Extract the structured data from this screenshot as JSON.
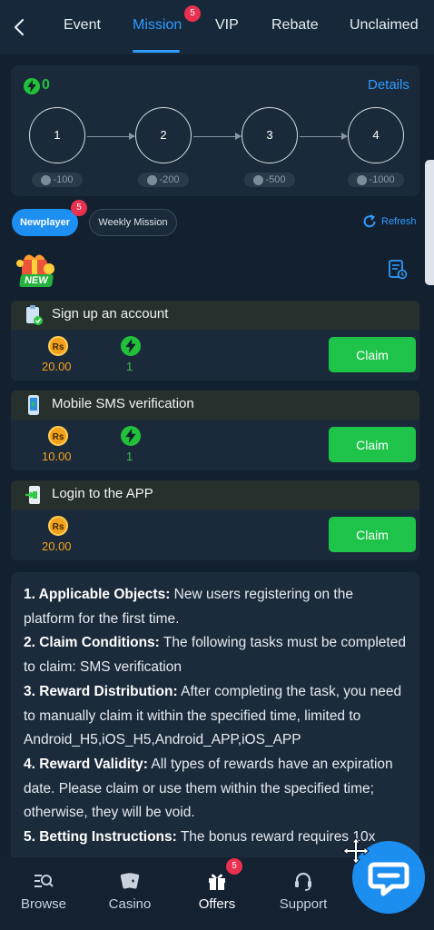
{
  "tabs": [
    {
      "label": "Event"
    },
    {
      "label": "Mission",
      "badge": "5",
      "active": true
    },
    {
      "label": "VIP"
    },
    {
      "label": "Rebate"
    },
    {
      "label": "Unclaimed"
    }
  ],
  "progress": {
    "energy_value": "0",
    "details_label": "Details",
    "steps": [
      {
        "label": "1",
        "requirement": "-100"
      },
      {
        "label": "2",
        "requirement": "-200"
      },
      {
        "label": "3",
        "requirement": "-500"
      },
      {
        "label": "4",
        "requirement": "-1000"
      }
    ]
  },
  "filters": {
    "newplayer_label": "Newplayer",
    "newplayer_badge": "5",
    "weekly_label": "Weekly Mission",
    "refresh_label": "Refresh"
  },
  "new_badge_text": "NEW",
  "tasks": [
    {
      "title": "Sign up an account",
      "rs_icon": "Rs",
      "rs_value": "20.00",
      "energy_value": "1",
      "claim_label": "Claim"
    },
    {
      "title": "Mobile SMS verification",
      "rs_icon": "Rs",
      "rs_value": "10.00",
      "energy_value": "1",
      "claim_label": "Claim"
    },
    {
      "title": "Login to the APP",
      "rs_icon": "Rs",
      "rs_value": "20.00",
      "claim_label": "Claim"
    }
  ],
  "rules": [
    {
      "heading": "1. Applicable Objects:",
      "text": " New users registering on the platform for the first time."
    },
    {
      "heading": "2. Claim Conditions:",
      "text": " The following tasks must be completed to claim: SMS verification"
    },
    {
      "heading": "3. Reward Distribution:",
      "text": " After completing the task, you need to manually claim it within the specified time, limited to Android_H5,iOS_H5,Android_APP,iOS_APP"
    },
    {
      "heading": "4. Reward Validity:",
      "text": " All types of rewards have an expiration date. Please claim or use them within the specified time; otherwise, they will be void."
    },
    {
      "heading": "5. Betting Instructions:",
      "text": " The bonus reward requires 10x"
    }
  ],
  "bottom_nav": [
    {
      "label": "Browse",
      "icon": "browse-icon"
    },
    {
      "label": "Casino",
      "icon": "cards-icon"
    },
    {
      "label": "Offers",
      "icon": "gift-icon",
      "badge": "5",
      "active": true
    },
    {
      "label": "Support",
      "icon": "headset-icon"
    }
  ],
  "colors": {
    "accent_blue": "#2f9bff",
    "claim_green": "#1ec449",
    "energy_green": "#21c23a",
    "coin_orange": "#f2a11c",
    "badge_red": "#e9304f"
  }
}
